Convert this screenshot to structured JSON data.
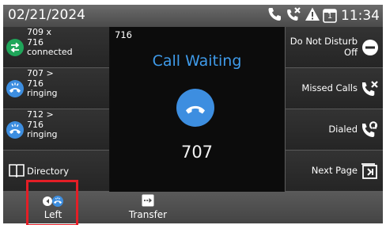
{
  "status_bar": {
    "date": "02/21/2024",
    "time": "11:34",
    "icons": [
      "phone-icon",
      "missed-call-icon",
      "warning-icon",
      "line-number-icon"
    ],
    "line_indicator": "1"
  },
  "line_keys": [
    {
      "lines": [
        "709 x",
        "716",
        "connected"
      ],
      "state": "connected",
      "color": "#1fa65a"
    },
    {
      "lines": [
        "707 >",
        "716",
        "ringing"
      ],
      "state": "ringing",
      "color": "#3d8ee0"
    },
    {
      "lines": [
        "712 >",
        "716",
        "ringing"
      ],
      "state": "ringing",
      "color": "#3d8ee0"
    }
  ],
  "directory_label": "Directory",
  "right_keys": {
    "dnd_line1": "Do Not Disturb",
    "dnd_line2": "Off",
    "missed": "Missed Calls",
    "dialed": "Dialed",
    "next_page": "Next Page"
  },
  "call": {
    "line": "716",
    "status": "Call Waiting",
    "number": "707",
    "accent": "#3f9bea"
  },
  "softkeys": {
    "left": "Left",
    "transfer": "Transfer"
  },
  "colors": {
    "highlight": "#e41e26",
    "ringing_blue": "#3d8ee0",
    "connected_green": "#1fa65a"
  }
}
